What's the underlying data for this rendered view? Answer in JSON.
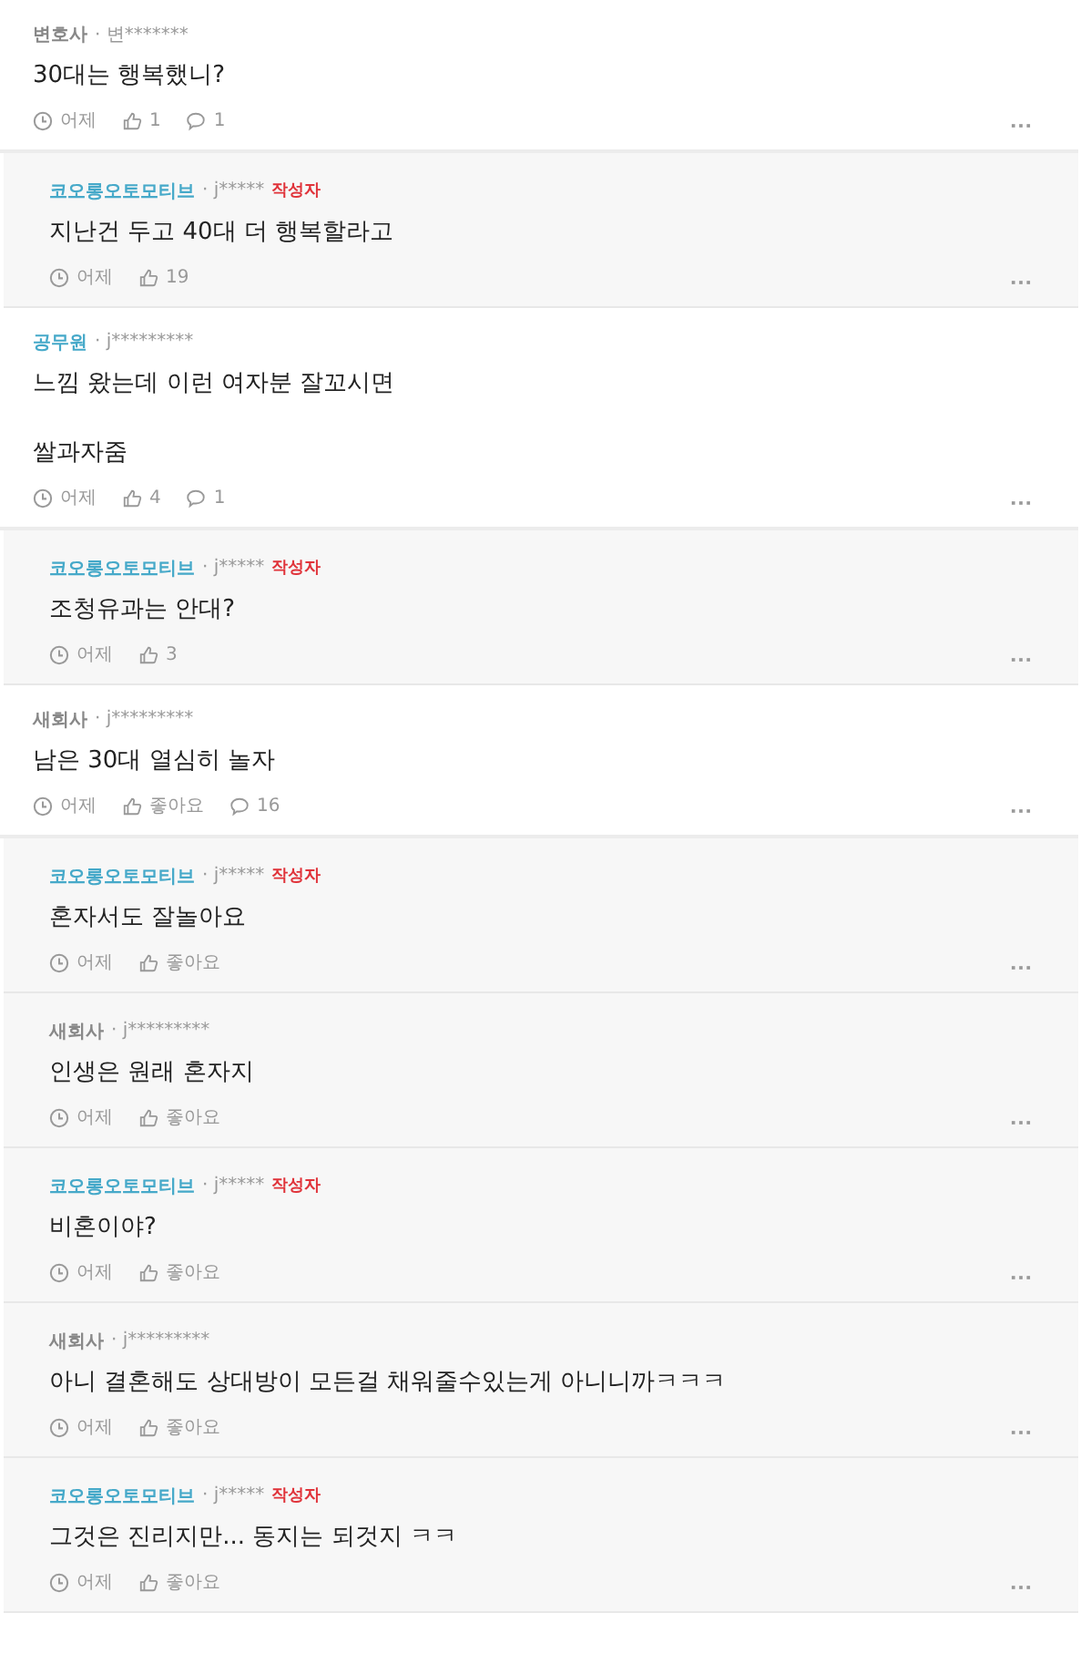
{
  "comments": [
    {
      "kind": "comment",
      "company": "변호사",
      "highlighted": false,
      "user": "· 변*******",
      "paragraphs": [
        "30대는 행복했니?"
      ],
      "time": "어제",
      "likes": "1",
      "replies": "1"
    },
    {
      "kind": "reply",
      "company": "코오롱오토모티브",
      "highlighted": true,
      "user": "· j*****",
      "author_badge": "작성자",
      "paragraphs": [
        "지난건 두고 40대 더 행복할라고"
      ],
      "time": "어제",
      "likes": "19"
    },
    {
      "kind": "comment",
      "company": "공무원",
      "highlighted": true,
      "user": "· j*********",
      "paragraphs": [
        "느낌 왔는데 이런 여자분 잘꼬시면",
        "쌀과자줌"
      ],
      "time": "어제",
      "likes": "4",
      "replies": "1"
    },
    {
      "kind": "reply",
      "company": "코오롱오토모티브",
      "highlighted": true,
      "user": "· j*****",
      "author_badge": "작성자",
      "paragraphs": [
        "조청유과는 안대?"
      ],
      "time": "어제",
      "likes": "3"
    },
    {
      "kind": "comment",
      "company": "새회사",
      "highlighted": false,
      "user": "· j*********",
      "paragraphs": [
        "남은 30대 열심히 놀자"
      ],
      "time": "어제",
      "likes": "좋아요",
      "replies": "16"
    },
    {
      "kind": "reply",
      "company": "코오롱오토모티브",
      "highlighted": true,
      "user": "· j*****",
      "author_badge": "작성자",
      "paragraphs": [
        "혼자서도 잘놀아요"
      ],
      "time": "어제",
      "likes": "좋아요"
    },
    {
      "kind": "reply",
      "company": "새회사",
      "highlighted": false,
      "user": "· j*********",
      "paragraphs": [
        "인생은 원래 혼자지"
      ],
      "time": "어제",
      "likes": "좋아요"
    },
    {
      "kind": "reply",
      "company": "코오롱오토모티브",
      "highlighted": true,
      "user": "· j*****",
      "author_badge": "작성자",
      "paragraphs": [
        "비혼이야?"
      ],
      "time": "어제",
      "likes": "좋아요"
    },
    {
      "kind": "reply",
      "company": "새회사",
      "highlighted": false,
      "user": "· j*********",
      "paragraphs": [
        "아니 결혼해도 상대방이 모든걸 채워줄수있는게 아니니까ㅋㅋㅋ"
      ],
      "time": "어제",
      "likes": "좋아요"
    },
    {
      "kind": "reply",
      "company": "코오롱오토모티브",
      "highlighted": true,
      "user": "· j*****",
      "author_badge": "작성자",
      "paragraphs": [
        "그것은 진리지만... 동지는 되것지 ㅋㅋ"
      ],
      "time": "어제",
      "likes": "좋아요"
    }
  ]
}
